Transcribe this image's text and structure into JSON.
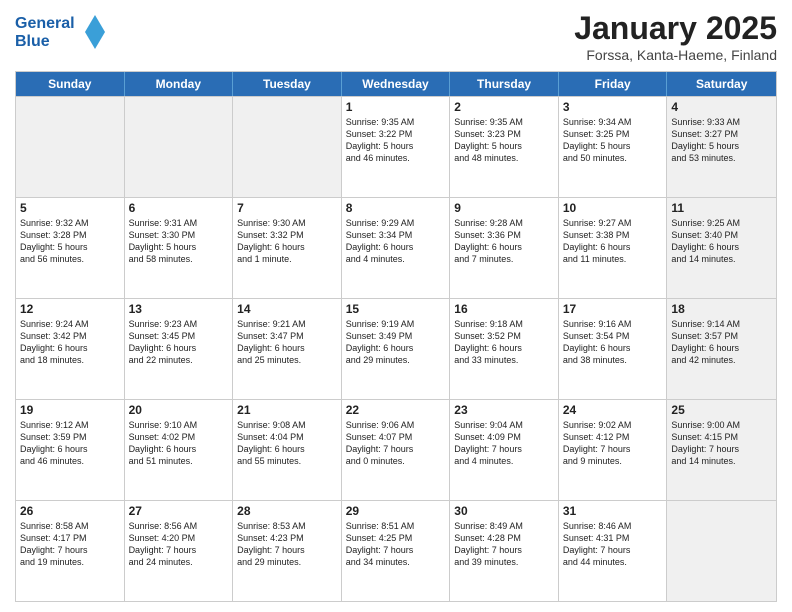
{
  "header": {
    "logo_line1": "General",
    "logo_line2": "Blue",
    "month_title": "January 2025",
    "subtitle": "Forssa, Kanta-Haeme, Finland"
  },
  "weekdays": [
    "Sunday",
    "Monday",
    "Tuesday",
    "Wednesday",
    "Thursday",
    "Friday",
    "Saturday"
  ],
  "weeks": [
    [
      {
        "day": "",
        "info": "",
        "shaded": true
      },
      {
        "day": "",
        "info": "",
        "shaded": true
      },
      {
        "day": "",
        "info": "",
        "shaded": true
      },
      {
        "day": "1",
        "info": "Sunrise: 9:35 AM\nSunset: 3:22 PM\nDaylight: 5 hours\nand 46 minutes."
      },
      {
        "day": "2",
        "info": "Sunrise: 9:35 AM\nSunset: 3:23 PM\nDaylight: 5 hours\nand 48 minutes."
      },
      {
        "day": "3",
        "info": "Sunrise: 9:34 AM\nSunset: 3:25 PM\nDaylight: 5 hours\nand 50 minutes."
      },
      {
        "day": "4",
        "info": "Sunrise: 9:33 AM\nSunset: 3:27 PM\nDaylight: 5 hours\nand 53 minutes.",
        "shaded": true
      }
    ],
    [
      {
        "day": "5",
        "info": "Sunrise: 9:32 AM\nSunset: 3:28 PM\nDaylight: 5 hours\nand 56 minutes."
      },
      {
        "day": "6",
        "info": "Sunrise: 9:31 AM\nSunset: 3:30 PM\nDaylight: 5 hours\nand 58 minutes."
      },
      {
        "day": "7",
        "info": "Sunrise: 9:30 AM\nSunset: 3:32 PM\nDaylight: 6 hours\nand 1 minute."
      },
      {
        "day": "8",
        "info": "Sunrise: 9:29 AM\nSunset: 3:34 PM\nDaylight: 6 hours\nand 4 minutes."
      },
      {
        "day": "9",
        "info": "Sunrise: 9:28 AM\nSunset: 3:36 PM\nDaylight: 6 hours\nand 7 minutes."
      },
      {
        "day": "10",
        "info": "Sunrise: 9:27 AM\nSunset: 3:38 PM\nDaylight: 6 hours\nand 11 minutes."
      },
      {
        "day": "11",
        "info": "Sunrise: 9:25 AM\nSunset: 3:40 PM\nDaylight: 6 hours\nand 14 minutes.",
        "shaded": true
      }
    ],
    [
      {
        "day": "12",
        "info": "Sunrise: 9:24 AM\nSunset: 3:42 PM\nDaylight: 6 hours\nand 18 minutes."
      },
      {
        "day": "13",
        "info": "Sunrise: 9:23 AM\nSunset: 3:45 PM\nDaylight: 6 hours\nand 22 minutes."
      },
      {
        "day": "14",
        "info": "Sunrise: 9:21 AM\nSunset: 3:47 PM\nDaylight: 6 hours\nand 25 minutes."
      },
      {
        "day": "15",
        "info": "Sunrise: 9:19 AM\nSunset: 3:49 PM\nDaylight: 6 hours\nand 29 minutes."
      },
      {
        "day": "16",
        "info": "Sunrise: 9:18 AM\nSunset: 3:52 PM\nDaylight: 6 hours\nand 33 minutes."
      },
      {
        "day": "17",
        "info": "Sunrise: 9:16 AM\nSunset: 3:54 PM\nDaylight: 6 hours\nand 38 minutes."
      },
      {
        "day": "18",
        "info": "Sunrise: 9:14 AM\nSunset: 3:57 PM\nDaylight: 6 hours\nand 42 minutes.",
        "shaded": true
      }
    ],
    [
      {
        "day": "19",
        "info": "Sunrise: 9:12 AM\nSunset: 3:59 PM\nDaylight: 6 hours\nand 46 minutes."
      },
      {
        "day": "20",
        "info": "Sunrise: 9:10 AM\nSunset: 4:02 PM\nDaylight: 6 hours\nand 51 minutes."
      },
      {
        "day": "21",
        "info": "Sunrise: 9:08 AM\nSunset: 4:04 PM\nDaylight: 6 hours\nand 55 minutes."
      },
      {
        "day": "22",
        "info": "Sunrise: 9:06 AM\nSunset: 4:07 PM\nDaylight: 7 hours\nand 0 minutes."
      },
      {
        "day": "23",
        "info": "Sunrise: 9:04 AM\nSunset: 4:09 PM\nDaylight: 7 hours\nand 4 minutes."
      },
      {
        "day": "24",
        "info": "Sunrise: 9:02 AM\nSunset: 4:12 PM\nDaylight: 7 hours\nand 9 minutes."
      },
      {
        "day": "25",
        "info": "Sunrise: 9:00 AM\nSunset: 4:15 PM\nDaylight: 7 hours\nand 14 minutes.",
        "shaded": true
      }
    ],
    [
      {
        "day": "26",
        "info": "Sunrise: 8:58 AM\nSunset: 4:17 PM\nDaylight: 7 hours\nand 19 minutes."
      },
      {
        "day": "27",
        "info": "Sunrise: 8:56 AM\nSunset: 4:20 PM\nDaylight: 7 hours\nand 24 minutes."
      },
      {
        "day": "28",
        "info": "Sunrise: 8:53 AM\nSunset: 4:23 PM\nDaylight: 7 hours\nand 29 minutes."
      },
      {
        "day": "29",
        "info": "Sunrise: 8:51 AM\nSunset: 4:25 PM\nDaylight: 7 hours\nand 34 minutes."
      },
      {
        "day": "30",
        "info": "Sunrise: 8:49 AM\nSunset: 4:28 PM\nDaylight: 7 hours\nand 39 minutes."
      },
      {
        "day": "31",
        "info": "Sunrise: 8:46 AM\nSunset: 4:31 PM\nDaylight: 7 hours\nand 44 minutes."
      },
      {
        "day": "",
        "info": "",
        "shaded": true
      }
    ]
  ]
}
